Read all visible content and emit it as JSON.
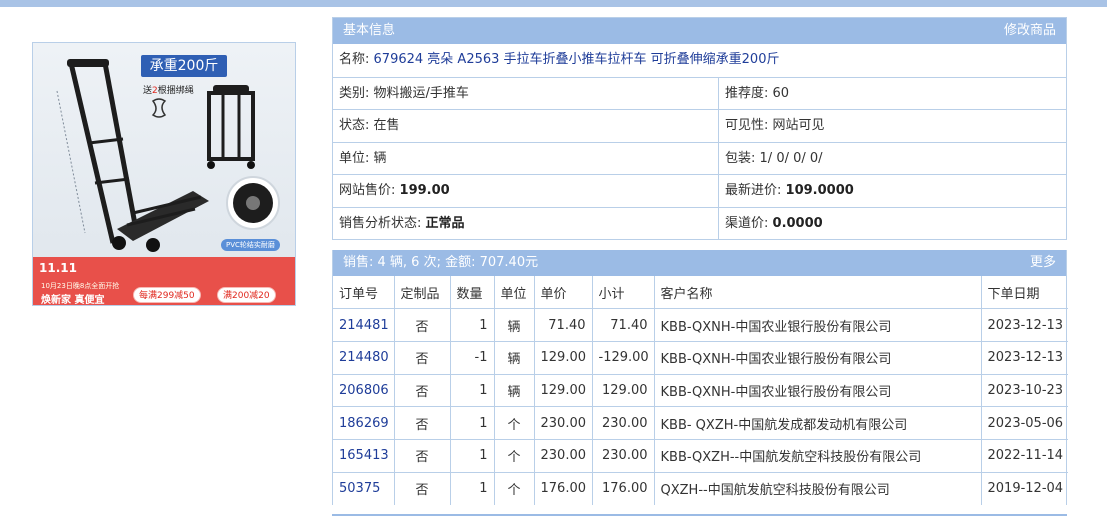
{
  "colors": {
    "accent": "#9bbbe5",
    "border": "#b9cfe8",
    "link": "#1f3d99",
    "topbar": "#a9c3e6"
  },
  "product_image": {
    "title": "承重200斤",
    "subtitle_prefix": "送",
    "subtitle_red": "2",
    "subtitle_suffix": "根捆绑绳",
    "pvc_label": "PVC轮结实耐磨",
    "banner_logo": "11.11",
    "banner_small": "10月23日晚8点全面开抢",
    "banner_main": "焕新家 真便宜",
    "coupon1": "每满299减50",
    "coupon2": "满200减20"
  },
  "info": {
    "header_title": "基本信息",
    "header_action": "修改商品",
    "name_label": "名称:",
    "name_value": "679624 亮朵 A2563 手拉车折叠小推车拉杆车 可折叠伸缩承重200斤",
    "category_label": "类别:",
    "category_value": "物料搬运/手推车",
    "recommend_label": "推荐度:",
    "recommend_value": "60",
    "status_label": "状态:",
    "status_value": "在售",
    "visibility_label": "可见性:",
    "visibility_value": "网站可见",
    "unit_label": "单位:",
    "unit_value": "辆",
    "package_label": "包装:",
    "package_value": "1/ 0/ 0/ 0/",
    "site_price_label": "网站售价:",
    "site_price_value": "199.00",
    "latest_cost_label": "最新进价:",
    "latest_cost_value": "109.0000",
    "analysis_label": "销售分析状态:",
    "analysis_value": "正常品",
    "channel_price_label": "渠道价:",
    "channel_price_value": "0.0000"
  },
  "sales": {
    "header_summary": "销售: 4 辆, 6 次; 金额: 707.40元",
    "header_action": "更多",
    "columns": [
      "订单号",
      "定制品",
      "数量",
      "单位",
      "单价",
      "小计",
      "客户名称",
      "下单日期"
    ],
    "rows": [
      {
        "order_no": "214481",
        "custom": "否",
        "qty": "1",
        "unit": "辆",
        "price": "71.40",
        "subtotal": "71.40",
        "customer": "KBB-QXNH-中国农业银行股份有限公司",
        "date": "2023-12-13"
      },
      {
        "order_no": "214480",
        "custom": "否",
        "qty": "-1",
        "unit": "辆",
        "price": "129.00",
        "subtotal": "-129.00",
        "customer": "KBB-QXNH-中国农业银行股份有限公司",
        "date": "2023-12-13"
      },
      {
        "order_no": "206806",
        "custom": "否",
        "qty": "1",
        "unit": "辆",
        "price": "129.00",
        "subtotal": "129.00",
        "customer": "KBB-QXNH-中国农业银行股份有限公司",
        "date": "2023-10-23"
      },
      {
        "order_no": "186269",
        "custom": "否",
        "qty": "1",
        "unit": "个",
        "price": "230.00",
        "subtotal": "230.00",
        "customer": "KBB- QXZH-中国航发成都发动机有限公司",
        "date": "2023-05-06"
      },
      {
        "order_no": "165413",
        "custom": "否",
        "qty": "1",
        "unit": "个",
        "price": "230.00",
        "subtotal": "230.00",
        "customer": "KBB-QXZH--中国航发航空科技股份有限公司",
        "date": "2022-11-14"
      },
      {
        "order_no": "50375",
        "custom": "否",
        "qty": "1",
        "unit": "个",
        "price": "176.00",
        "subtotal": "176.00",
        "customer": "QXZH--中国航发航空科技股份有限公司",
        "date": "2019-12-04"
      }
    ]
  }
}
